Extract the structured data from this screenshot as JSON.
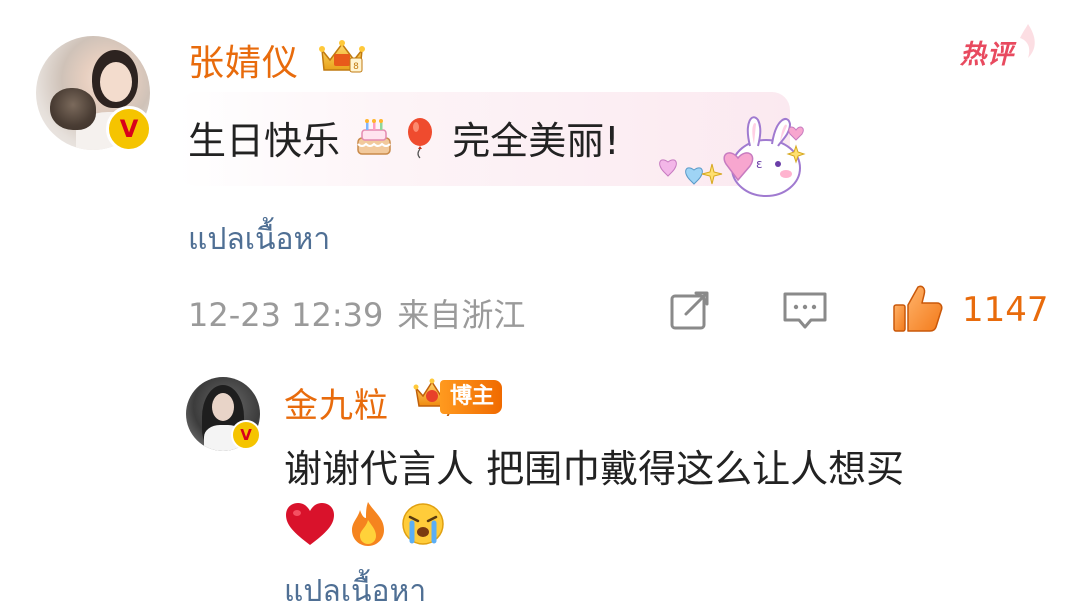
{
  "main_comment": {
    "username": "张婧仪",
    "text_before": "生日快乐",
    "text_after": "完全美丽!",
    "inline_emojis": [
      "birthday-cake-icon",
      "balloon-icon"
    ],
    "translate_label": "แปลเนื้อหา",
    "hot_tag": "热评",
    "time": "12-23 12:39",
    "location": "来自浙江",
    "like_count": "1147",
    "icons": [
      "repost-icon",
      "comment-icon",
      "like-icon"
    ]
  },
  "reply": {
    "username": "金九粒",
    "badge": "博主",
    "text": "谢谢代言人 把围巾戴得这么让人想买",
    "emojis": [
      "red-heart-icon",
      "fire-icon",
      "crying-face-icon"
    ],
    "translate_label": "แปลเนื้อหา"
  },
  "colors": {
    "username": "#e86b0c",
    "translate_link": "#4f6f94",
    "meta_text": "#9a9a9a",
    "hot_tag": "#e84a5f",
    "verified_badge": "#f5c400"
  }
}
